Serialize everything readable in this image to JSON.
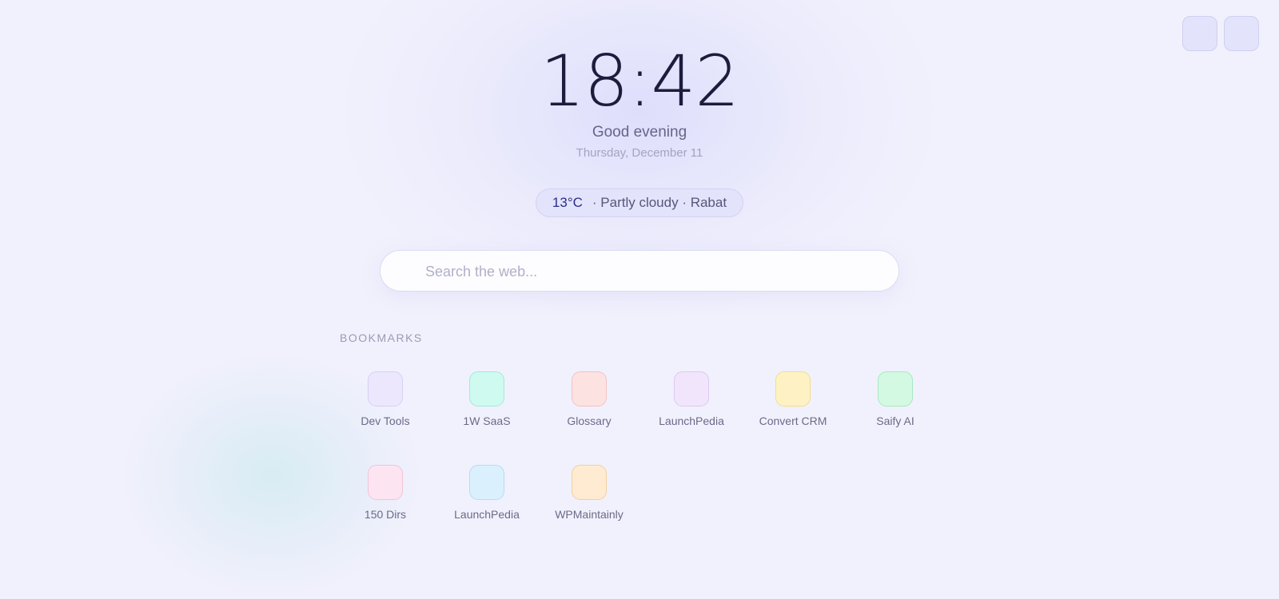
{
  "clock": {
    "time": "18:42",
    "greeting": "Good evening",
    "date": "Thursday, December 11"
  },
  "weather": {
    "temperature": "13°C",
    "details": "· Partly cloudy · Rabat"
  },
  "search": {
    "placeholder": "Search the web..."
  },
  "bookmarks": {
    "heading": "BOOKMARKS",
    "items": [
      {
        "label": "Dev Tools",
        "color": "#ece7fd",
        "border": "#d6d0f3"
      },
      {
        "label": "1W SaaS",
        "color": "#cefaf0",
        "border": "#a5e9d9"
      },
      {
        "label": "Glossary",
        "color": "#fde2e2",
        "border": "#f2c3c3"
      },
      {
        "label": "LaunchPedia",
        "color": "#f1e5fc",
        "border": "#ddc8f1"
      },
      {
        "label": "Convert CRM",
        "color": "#fef2c4",
        "border": "#f1dd94"
      },
      {
        "label": "Saify AI",
        "color": "#d3f9e2",
        "border": "#a7e8c3"
      },
      {
        "label": "150 Dirs",
        "color": "#fce5f1",
        "border": "#f1c3dc"
      },
      {
        "label": "LaunchPedia",
        "color": "#dbf0fd",
        "border": "#b3dcf2"
      },
      {
        "label": "WPMaintainly",
        "color": "#feebd1",
        "border": "#f4cf9f"
      }
    ]
  },
  "colors": {
    "background": "#f1f1fd",
    "accent": "#2d2d86",
    "text_primary": "#1c1c3d"
  }
}
